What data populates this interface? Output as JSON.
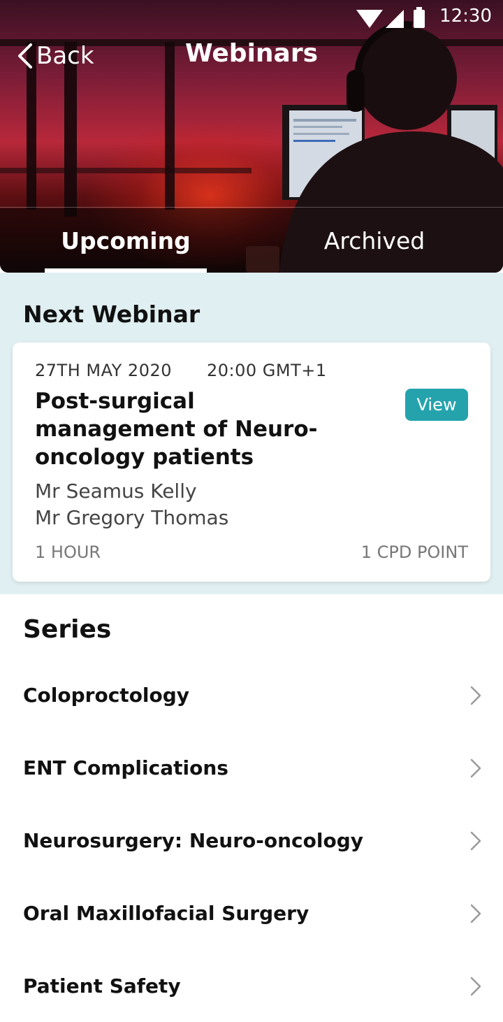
{
  "status_bar": {
    "time": "12:30"
  },
  "nav": {
    "back_label": "Back",
    "title": "Webinars"
  },
  "tabs": [
    {
      "label": "Upcoming",
      "active": true
    },
    {
      "label": "Archived",
      "active": false
    }
  ],
  "next_webinar": {
    "heading": "Next Webinar",
    "date": "27TH MAY 2020",
    "time": "20:00 GMT+1",
    "title": "Post-surgical management of Neuro-oncology patients",
    "view_label": "View",
    "speakers": [
      "Mr Seamus Kelly",
      "Mr Gregory Thomas"
    ],
    "duration": "1 HOUR",
    "cpd": "1 CPD POINT"
  },
  "series": {
    "heading": "Series",
    "items": [
      {
        "label": "Coloproctology"
      },
      {
        "label": "ENT Complications"
      },
      {
        "label": "Neurosurgery: Neuro-oncology"
      },
      {
        "label": "Oral Maxillofacial Surgery"
      },
      {
        "label": "Patient Safety"
      }
    ]
  },
  "colors": {
    "accent": "#25a3ad",
    "section_bg": "#e0eff2"
  },
  "icons": [
    "wifi-icon",
    "signal-icon",
    "battery-icon",
    "chevron-left-icon",
    "chevron-right-icon"
  ]
}
